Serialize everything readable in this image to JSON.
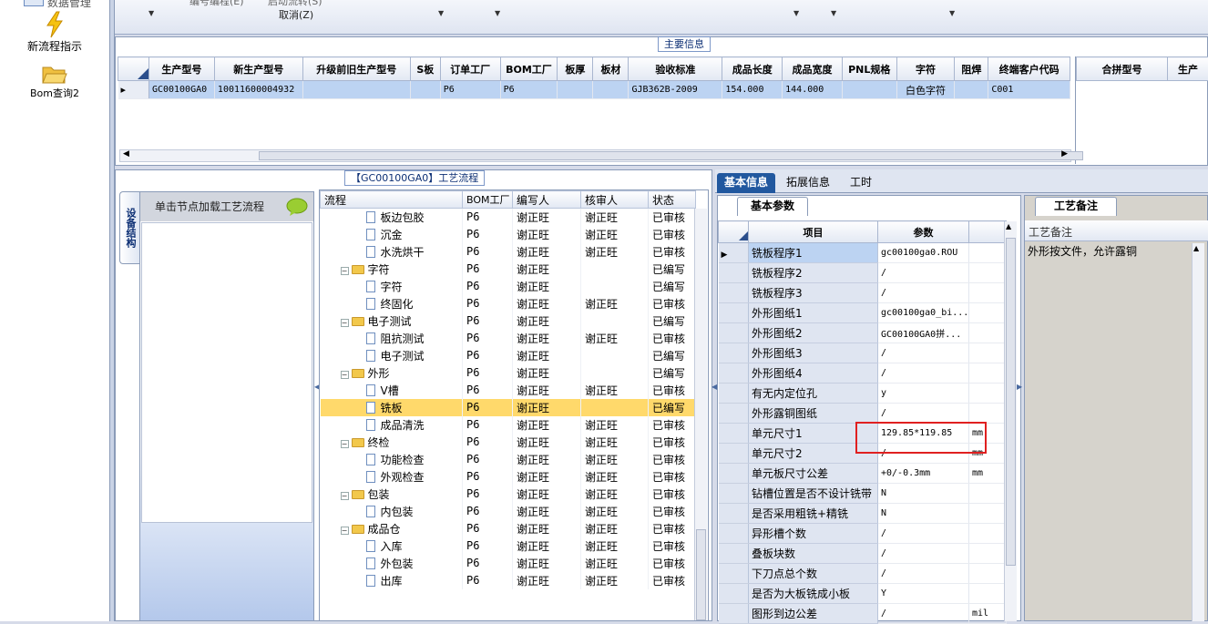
{
  "left_nav": {
    "items": [
      {
        "label": "数据管理",
        "icon": "data-manage-icon"
      },
      {
        "label": "新流程指示",
        "icon": "lightning-icon"
      },
      {
        "label": "Bom查询2",
        "icon": "folder-open-icon"
      }
    ]
  },
  "toolbar": {
    "label1": "编号编程(E)",
    "label2": "启动流转(S)",
    "label3": "取消(Z)"
  },
  "main_info": {
    "group_title": "主要信息",
    "columns": [
      "生产型号",
      "新生产型号",
      "升级前旧生产型号",
      "S板",
      "订单工厂",
      "BOM工厂",
      "板厚",
      "板材",
      "验收标准",
      "成品长度",
      "成品宽度",
      "PNL规格",
      "字符",
      "阻焊",
      "终端客户代码"
    ],
    "row": [
      "GC00100GA0",
      "10011600004932",
      "",
      "",
      "P6",
      "P6",
      "",
      "",
      "GJB362B-2009",
      "154.000",
      "144.000",
      "",
      "白色字符",
      "",
      "C001"
    ],
    "merge_columns": [
      "合拼型号",
      "生产"
    ]
  },
  "process": {
    "group_title": "【GC00100GA0】工艺流程",
    "vertical_tab": "设备结构",
    "hint": "单击节点加载工艺流程",
    "columns": [
      "流程",
      "BOM工厂",
      "编写人",
      "核审人",
      "状态"
    ],
    "rows": [
      {
        "level": 2,
        "name": "板边包胶",
        "bom": "P6",
        "writer": "谢正旺",
        "reviewer": "谢正旺",
        "status": "已审核"
      },
      {
        "level": 2,
        "name": "沉金",
        "bom": "P6",
        "writer": "谢正旺",
        "reviewer": "谢正旺",
        "status": "已审核"
      },
      {
        "level": 2,
        "name": "水洗烘干",
        "bom": "P6",
        "writer": "谢正旺",
        "reviewer": "谢正旺",
        "status": "已审核"
      },
      {
        "level": 1,
        "name": "字符",
        "bom": "P6",
        "writer": "谢正旺",
        "reviewer": "",
        "status": "已编写"
      },
      {
        "level": 2,
        "name": "字符",
        "bom": "P6",
        "writer": "谢正旺",
        "reviewer": "",
        "status": "已编写"
      },
      {
        "level": 2,
        "name": "终固化",
        "bom": "P6",
        "writer": "谢正旺",
        "reviewer": "谢正旺",
        "status": "已审核"
      },
      {
        "level": 1,
        "name": "电子测试",
        "bom": "P6",
        "writer": "谢正旺",
        "reviewer": "",
        "status": "已编写"
      },
      {
        "level": 2,
        "name": "阻抗测试",
        "bom": "P6",
        "writer": "谢正旺",
        "reviewer": "谢正旺",
        "status": "已审核"
      },
      {
        "level": 2,
        "name": "电子测试",
        "bom": "P6",
        "writer": "谢正旺",
        "reviewer": "",
        "status": "已编写"
      },
      {
        "level": 1,
        "name": "外形",
        "bom": "P6",
        "writer": "谢正旺",
        "reviewer": "",
        "status": "已编写"
      },
      {
        "level": 2,
        "name": "V槽",
        "bom": "P6",
        "writer": "谢正旺",
        "reviewer": "谢正旺",
        "status": "已审核"
      },
      {
        "level": 2,
        "name": "铣板",
        "bom": "P6",
        "writer": "谢正旺",
        "reviewer": "",
        "status": "已编写"
      },
      {
        "level": 2,
        "name": "成品清洗",
        "bom": "P6",
        "writer": "谢正旺",
        "reviewer": "谢正旺",
        "status": "已审核"
      },
      {
        "level": 1,
        "name": "终检",
        "bom": "P6",
        "writer": "谢正旺",
        "reviewer": "谢正旺",
        "status": "已审核"
      },
      {
        "level": 2,
        "name": "功能检查",
        "bom": "P6",
        "writer": "谢正旺",
        "reviewer": "谢正旺",
        "status": "已审核"
      },
      {
        "level": 2,
        "name": "外观检查",
        "bom": "P6",
        "writer": "谢正旺",
        "reviewer": "谢正旺",
        "status": "已审核"
      },
      {
        "level": 1,
        "name": "包装",
        "bom": "P6",
        "writer": "谢正旺",
        "reviewer": "谢正旺",
        "status": "已审核"
      },
      {
        "level": 2,
        "name": "内包装",
        "bom": "P6",
        "writer": "谢正旺",
        "reviewer": "谢正旺",
        "status": "已审核"
      },
      {
        "level": 1,
        "name": "成品仓",
        "bom": "P6",
        "writer": "谢正旺",
        "reviewer": "谢正旺",
        "status": "已审核"
      },
      {
        "level": 2,
        "name": "入库",
        "bom": "P6",
        "writer": "谢正旺",
        "reviewer": "谢正旺",
        "status": "已审核"
      },
      {
        "level": 2,
        "name": "外包装",
        "bom": "P6",
        "writer": "谢正旺",
        "reviewer": "谢正旺",
        "status": "已审核"
      },
      {
        "level": 2,
        "name": "出库",
        "bom": "P6",
        "writer": "谢正旺",
        "reviewer": "谢正旺",
        "status": "已审核"
      }
    ],
    "selected_index": 11
  },
  "right_tabs": [
    "基本信息",
    "拓展信息",
    "工时"
  ],
  "basic_params": {
    "tab_label": "基本参数",
    "columns": [
      "项目",
      "参数"
    ],
    "rows": [
      {
        "item": "铣板程序1",
        "value": "gc00100ga0.ROU",
        "unit": ""
      },
      {
        "item": "铣板程序2",
        "value": "/",
        "unit": ""
      },
      {
        "item": "铣板程序3",
        "value": "/",
        "unit": ""
      },
      {
        "item": "外形图纸1",
        "value": "gc00100ga0_bi...",
        "unit": ""
      },
      {
        "item": "外形图纸2",
        "value": "GC00100GA0拼...",
        "unit": ""
      },
      {
        "item": "外形图纸3",
        "value": "/",
        "unit": ""
      },
      {
        "item": "外形图纸4",
        "value": "/",
        "unit": ""
      },
      {
        "item": "有无内定位孔",
        "value": "y",
        "unit": ""
      },
      {
        "item": "外形露铜图纸",
        "value": "/",
        "unit": ""
      },
      {
        "item": "单元尺寸1",
        "value": "129.85*119.85",
        "unit": "mm"
      },
      {
        "item": "单元尺寸2",
        "value": "/",
        "unit": "mm"
      },
      {
        "item": "单元板尺寸公差",
        "value": "+0/-0.3mm",
        "unit": "mm"
      },
      {
        "item": "钻槽位置是否不设计铣带",
        "value": "N",
        "unit": ""
      },
      {
        "item": "是否采用粗铣+精铣",
        "value": "N",
        "unit": ""
      },
      {
        "item": "异形槽个数",
        "value": "/",
        "unit": ""
      },
      {
        "item": "叠板块数",
        "value": "/",
        "unit": ""
      },
      {
        "item": "下刀点总个数",
        "value": "/",
        "unit": ""
      },
      {
        "item": "是否为大板铣成小板",
        "value": "Y",
        "unit": ""
      },
      {
        "item": "图形到边公差",
        "value": "/",
        "unit": "mil"
      }
    ]
  },
  "process_note": {
    "tab_label": "工艺备注",
    "header": "工艺备注",
    "text": "外形按文件，允许露铜"
  }
}
